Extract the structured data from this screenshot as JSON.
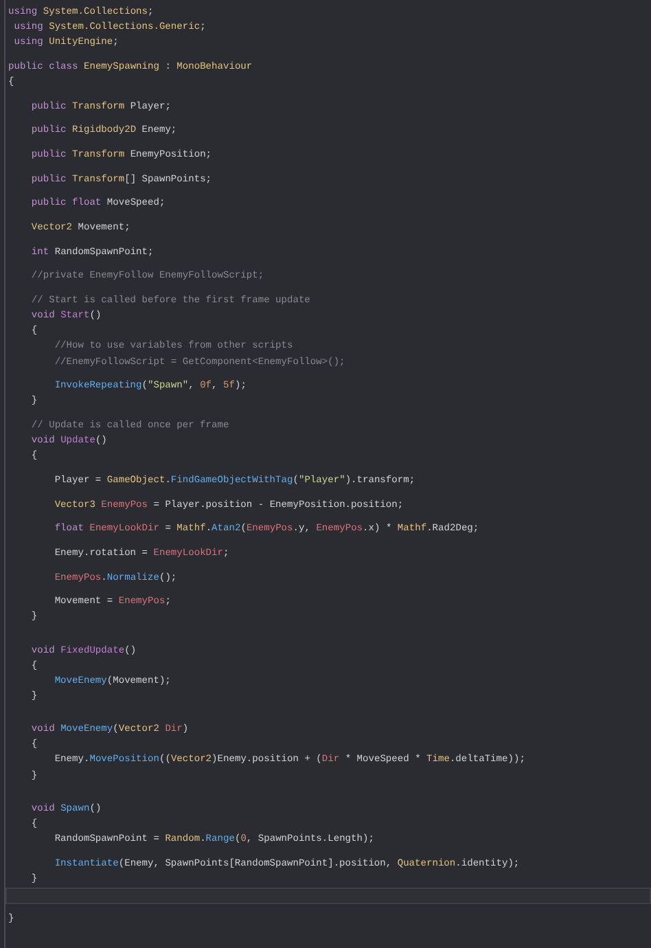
{
  "editor": {
    "lines": [
      {
        "kind": "code",
        "tokens": [
          {
            "kind": "keyword",
            "text": "using"
          },
          {
            "kind": "type",
            "text": " System.Collections"
          },
          {
            "kind": "plain",
            "text": ";"
          }
        ]
      },
      {
        "kind": "code",
        "tokens": [
          {
            "kind": "keyword",
            "text": " using"
          },
          {
            "kind": "type",
            "text": " System.Collections.Generic"
          },
          {
            "kind": "plain",
            "text": ";"
          }
        ]
      },
      {
        "kind": "code",
        "tokens": [
          {
            "kind": "keyword",
            "text": " using"
          },
          {
            "kind": "type",
            "text": " UnityEngine"
          },
          {
            "kind": "plain",
            "text": ";"
          }
        ]
      },
      {
        "kind": "blank"
      },
      {
        "kind": "code",
        "tokens": [
          {
            "kind": "keyword",
            "text": "public class "
          },
          {
            "kind": "type",
            "text": "EnemySpawning"
          },
          {
            "kind": "plain",
            "text": " : "
          },
          {
            "kind": "type",
            "text": "MonoBehaviour"
          }
        ]
      },
      {
        "kind": "code",
        "tokens": [
          {
            "kind": "plain",
            "text": "{"
          }
        ]
      },
      {
        "kind": "blank"
      },
      {
        "kind": "code",
        "tokens": [
          {
            "kind": "keyword",
            "text": "    public "
          },
          {
            "kind": "type",
            "text": "Transform"
          },
          {
            "kind": "plain",
            "text": " Player;"
          }
        ]
      },
      {
        "kind": "blank"
      },
      {
        "kind": "code",
        "tokens": [
          {
            "kind": "keyword",
            "text": "    public "
          },
          {
            "kind": "type",
            "text": "Rigidbody2D"
          },
          {
            "kind": "plain",
            "text": " Enemy;"
          }
        ]
      },
      {
        "kind": "blank"
      },
      {
        "kind": "code",
        "tokens": [
          {
            "kind": "keyword",
            "text": "    public "
          },
          {
            "kind": "type",
            "text": "Transform"
          },
          {
            "kind": "plain",
            "text": " EnemyPosition;"
          }
        ]
      },
      {
        "kind": "blank"
      },
      {
        "kind": "code",
        "tokens": [
          {
            "kind": "keyword",
            "text": "    public "
          },
          {
            "kind": "type",
            "text": "Transform"
          },
          {
            "kind": "plain",
            "text": "[] SpawnPoints;"
          }
        ]
      },
      {
        "kind": "blank"
      },
      {
        "kind": "code",
        "tokens": [
          {
            "kind": "keyword",
            "text": "    public float"
          },
          {
            "kind": "plain",
            "text": " MoveSpeed;"
          }
        ]
      },
      {
        "kind": "blank"
      },
      {
        "kind": "code",
        "tokens": [
          {
            "kind": "type",
            "text": "    Vector2"
          },
          {
            "kind": "plain",
            "text": " Movement;"
          }
        ]
      },
      {
        "kind": "blank"
      },
      {
        "kind": "code",
        "tokens": [
          {
            "kind": "keyword",
            "text": "    int"
          },
          {
            "kind": "plain",
            "text": " RandomSpawnPoint;"
          }
        ]
      },
      {
        "kind": "blank"
      },
      {
        "kind": "code",
        "tokens": [
          {
            "kind": "comment",
            "text": "    //private EnemyFollow EnemyFollowScript;"
          }
        ]
      },
      {
        "kind": "blank"
      },
      {
        "kind": "code",
        "tokens": [
          {
            "kind": "comment",
            "text": "    // Start is called before the first frame update"
          }
        ]
      },
      {
        "kind": "code",
        "tokens": [
          {
            "kind": "keyword",
            "text": "    void "
          },
          {
            "kind": "message",
            "text": "Start"
          },
          {
            "kind": "plain",
            "text": "()"
          }
        ]
      },
      {
        "kind": "code",
        "tokens": [
          {
            "kind": "plain",
            "text": "    {"
          }
        ]
      },
      {
        "kind": "code",
        "tokens": [
          {
            "kind": "comment",
            "text": "        //How to use variables from other scripts"
          }
        ]
      },
      {
        "kind": "code",
        "tokens": [
          {
            "kind": "comment",
            "text": "        //EnemyFollowScript = GetComponent<EnemyFollow>();"
          }
        ]
      },
      {
        "kind": "blank"
      },
      {
        "kind": "code",
        "tokens": [
          {
            "kind": "method",
            "text": "        InvokeRepeating"
          },
          {
            "kind": "plain",
            "text": "("
          },
          {
            "kind": "string",
            "text": "\"Spawn\""
          },
          {
            "kind": "plain",
            "text": ", "
          },
          {
            "kind": "number",
            "text": "0f"
          },
          {
            "kind": "plain",
            "text": ", "
          },
          {
            "kind": "number",
            "text": "5f"
          },
          {
            "kind": "plain",
            "text": ");"
          }
        ]
      },
      {
        "kind": "code",
        "tokens": [
          {
            "kind": "plain",
            "text": "    }"
          }
        ]
      },
      {
        "kind": "blank"
      },
      {
        "kind": "code",
        "tokens": [
          {
            "kind": "comment",
            "text": "    // Update is called once per frame"
          }
        ]
      },
      {
        "kind": "code",
        "tokens": [
          {
            "kind": "keyword",
            "text": "    void "
          },
          {
            "kind": "message",
            "text": "Update"
          },
          {
            "kind": "plain",
            "text": "()"
          }
        ]
      },
      {
        "kind": "code",
        "tokens": [
          {
            "kind": "plain",
            "text": "    {"
          }
        ]
      },
      {
        "kind": "blank"
      },
      {
        "kind": "code",
        "tokens": [
          {
            "kind": "plain",
            "text": "        Player = "
          },
          {
            "kind": "type",
            "text": "GameObject"
          },
          {
            "kind": "plain",
            "text": "."
          },
          {
            "kind": "method",
            "text": "FindGameObjectWithTag"
          },
          {
            "kind": "plain",
            "text": "("
          },
          {
            "kind": "string",
            "text": "\"Player\""
          },
          {
            "kind": "plain",
            "text": ").transform;"
          }
        ]
      },
      {
        "kind": "blank"
      },
      {
        "kind": "code",
        "tokens": [
          {
            "kind": "type",
            "text": "        Vector3 "
          },
          {
            "kind": "local",
            "text": "EnemyPos"
          },
          {
            "kind": "plain",
            "text": " = Player.position - EnemyPosition.position;"
          }
        ]
      },
      {
        "kind": "blank"
      },
      {
        "kind": "code",
        "tokens": [
          {
            "kind": "keyword",
            "text": "        float "
          },
          {
            "kind": "local",
            "text": "EnemyLookDir"
          },
          {
            "kind": "plain",
            "text": " = "
          },
          {
            "kind": "type",
            "text": "Mathf"
          },
          {
            "kind": "plain",
            "text": "."
          },
          {
            "kind": "method",
            "text": "Atan2"
          },
          {
            "kind": "plain",
            "text": "("
          },
          {
            "kind": "local",
            "text": "EnemyPos"
          },
          {
            "kind": "plain",
            "text": ".y, "
          },
          {
            "kind": "local",
            "text": "EnemyPos"
          },
          {
            "kind": "plain",
            "text": ".x) * "
          },
          {
            "kind": "type",
            "text": "Mathf"
          },
          {
            "kind": "plain",
            "text": ".Rad2Deg;"
          }
        ]
      },
      {
        "kind": "blank"
      },
      {
        "kind": "code",
        "tokens": [
          {
            "kind": "plain",
            "text": "        Enemy.rotation = "
          },
          {
            "kind": "local",
            "text": "EnemyLookDir"
          },
          {
            "kind": "plain",
            "text": ";"
          }
        ]
      },
      {
        "kind": "blank"
      },
      {
        "kind": "code",
        "tokens": [
          {
            "kind": "local",
            "text": "        EnemyPos"
          },
          {
            "kind": "plain",
            "text": "."
          },
          {
            "kind": "method",
            "text": "Normalize"
          },
          {
            "kind": "plain",
            "text": "();"
          }
        ]
      },
      {
        "kind": "blank"
      },
      {
        "kind": "code",
        "tokens": [
          {
            "kind": "plain",
            "text": "        Movement = "
          },
          {
            "kind": "local",
            "text": "EnemyPos"
          },
          {
            "kind": "plain",
            "text": ";"
          }
        ]
      },
      {
        "kind": "code",
        "tokens": [
          {
            "kind": "plain",
            "text": "    }"
          }
        ]
      },
      {
        "kind": "blank"
      },
      {
        "kind": "blank"
      },
      {
        "kind": "code",
        "tokens": [
          {
            "kind": "keyword",
            "text": "    void "
          },
          {
            "kind": "message",
            "text": "FixedUpdate"
          },
          {
            "kind": "plain",
            "text": "()"
          }
        ]
      },
      {
        "kind": "code",
        "tokens": [
          {
            "kind": "plain",
            "text": "    {"
          }
        ]
      },
      {
        "kind": "code",
        "tokens": [
          {
            "kind": "method",
            "text": "        MoveEnemy"
          },
          {
            "kind": "plain",
            "text": "(Movement);"
          }
        ]
      },
      {
        "kind": "code",
        "tokens": [
          {
            "kind": "plain",
            "text": "    }"
          }
        ]
      },
      {
        "kind": "blank"
      },
      {
        "kind": "blank"
      },
      {
        "kind": "code",
        "tokens": [
          {
            "kind": "keyword",
            "text": "    void "
          },
          {
            "kind": "method",
            "text": "MoveEnemy"
          },
          {
            "kind": "plain",
            "text": "("
          },
          {
            "kind": "type",
            "text": "Vector2"
          },
          {
            "kind": "local",
            "text": " Dir"
          },
          {
            "kind": "plain",
            "text": ")"
          }
        ]
      },
      {
        "kind": "code",
        "tokens": [
          {
            "kind": "plain",
            "text": "    {"
          }
        ]
      },
      {
        "kind": "code",
        "tokens": [
          {
            "kind": "plain",
            "text": "        Enemy."
          },
          {
            "kind": "method",
            "text": "MovePosition"
          },
          {
            "kind": "plain",
            "text": "(("
          },
          {
            "kind": "type",
            "text": "Vector2"
          },
          {
            "kind": "plain",
            "text": ")Enemy.position + ("
          },
          {
            "kind": "local",
            "text": "Dir"
          },
          {
            "kind": "plain",
            "text": " * MoveSpeed * "
          },
          {
            "kind": "type",
            "text": "Time"
          },
          {
            "kind": "plain",
            "text": ".deltaTime));"
          }
        ]
      },
      {
        "kind": "code",
        "tokens": [
          {
            "kind": "plain",
            "text": "    }"
          }
        ]
      },
      {
        "kind": "blank"
      },
      {
        "kind": "blank"
      },
      {
        "kind": "code",
        "tokens": [
          {
            "kind": "keyword",
            "text": "    void "
          },
          {
            "kind": "method",
            "text": "Spawn"
          },
          {
            "kind": "plain",
            "text": "()"
          }
        ]
      },
      {
        "kind": "code",
        "tokens": [
          {
            "kind": "plain",
            "text": "    {"
          }
        ]
      },
      {
        "kind": "code",
        "tokens": [
          {
            "kind": "plain",
            "text": "        RandomSpawnPoint = "
          },
          {
            "kind": "type",
            "text": "Random"
          },
          {
            "kind": "plain",
            "text": "."
          },
          {
            "kind": "method",
            "text": "Range"
          },
          {
            "kind": "plain",
            "text": "("
          },
          {
            "kind": "number",
            "text": "0"
          },
          {
            "kind": "plain",
            "text": ", SpawnPoints.Length);"
          }
        ]
      },
      {
        "kind": "blank"
      },
      {
        "kind": "code",
        "tokens": [
          {
            "kind": "method",
            "text": "        Instantiate"
          },
          {
            "kind": "plain",
            "text": "(Enemy, SpawnPoints[RandomSpawnPoint].position, "
          },
          {
            "kind": "type",
            "text": "Quaternion"
          },
          {
            "kind": "plain",
            "text": ".identity);"
          }
        ]
      },
      {
        "kind": "code",
        "tokens": [
          {
            "kind": "plain",
            "text": "    }"
          }
        ]
      },
      {
        "kind": "current"
      },
      {
        "kind": "blank"
      },
      {
        "kind": "code",
        "tokens": [
          {
            "kind": "plain",
            "text": "}"
          }
        ]
      }
    ]
  }
}
